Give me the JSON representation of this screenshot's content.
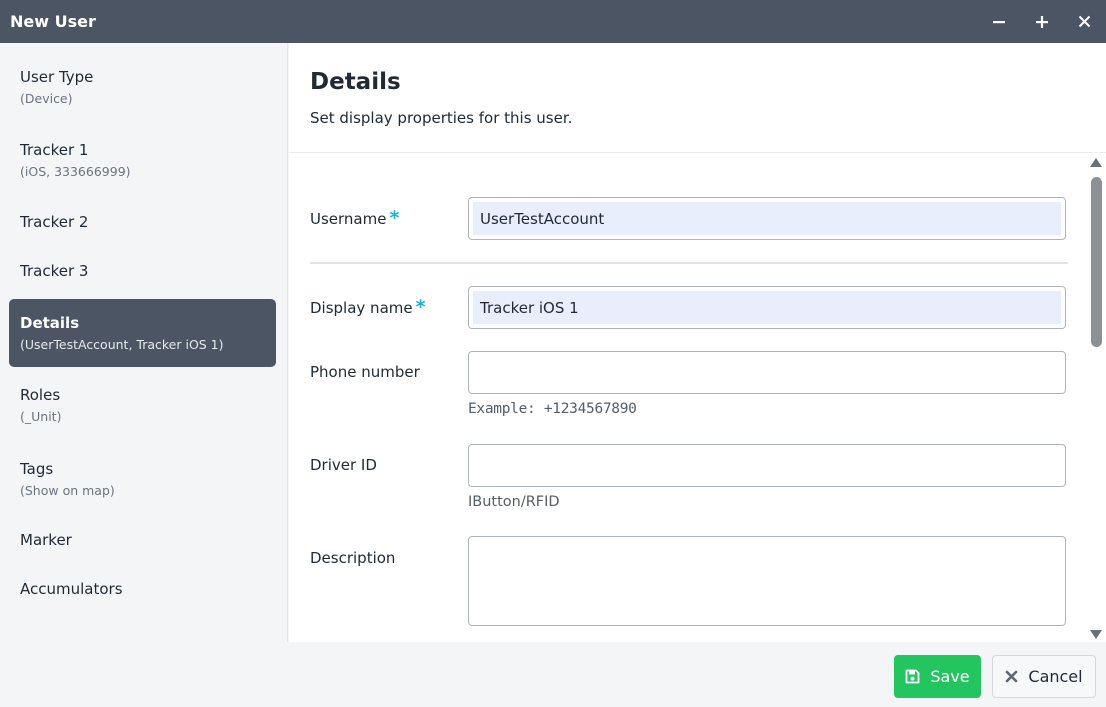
{
  "window": {
    "title": "New User",
    "controls": {
      "minimize": "−",
      "maximize": "+",
      "close": "×"
    }
  },
  "sidebar": {
    "items": [
      {
        "label": "User Type",
        "sub": "(Device)"
      },
      {
        "label": "Tracker 1",
        "sub": "(iOS, 333666999)"
      },
      {
        "label": "Tracker 2",
        "sub": ""
      },
      {
        "label": "Tracker 3",
        "sub": ""
      },
      {
        "label": "Details",
        "sub": "(UserTestAccount, Tracker iOS 1)",
        "active": true
      },
      {
        "label": "Roles",
        "sub": "(_Unit)"
      },
      {
        "label": "Tags",
        "sub": "(Show on map)"
      },
      {
        "label": "Marker",
        "sub": ""
      },
      {
        "label": "Accumulators",
        "sub": ""
      }
    ]
  },
  "main": {
    "title": "Details",
    "description": "Set display properties for this user.",
    "required_marker": "*",
    "fields": {
      "username": {
        "label": "Username",
        "value": "UserTestAccount",
        "required": true
      },
      "display_name": {
        "label": "Display name",
        "value": "Tracker iOS 1",
        "required": true
      },
      "phone": {
        "label": "Phone number",
        "value": "",
        "hint": "Example: +1234567890"
      },
      "driver_id": {
        "label": "Driver ID",
        "value": "",
        "hint": "IButton/RFID"
      },
      "description": {
        "label": "Description",
        "value": ""
      }
    }
  },
  "footer": {
    "save_label": "Save",
    "cancel_label": "Cancel"
  },
  "colors": {
    "titlebar": "#4b5563",
    "active_nav": "#4b5563",
    "required": "#14b4d8",
    "save_button": "#22c55e",
    "input_fill": "#e8eefb"
  },
  "icons": {
    "minimize": "minus-icon",
    "maximize": "plus-icon",
    "close": "close-icon",
    "save": "floppy-disk-icon",
    "cancel": "x-icon"
  }
}
